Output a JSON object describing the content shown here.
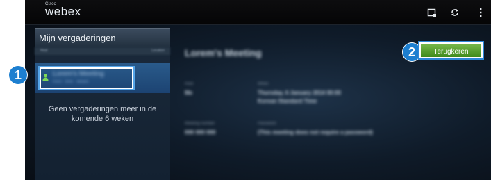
{
  "app": {
    "brand_top": "Cisco",
    "brand_name": "webex"
  },
  "toolbar": {
    "icons": [
      "add-meeting-icon",
      "refresh-icon",
      "more-icon"
    ]
  },
  "sidebar": {
    "title": "Mijn vergaderingen",
    "col_left": "Host",
    "col_right": "Location",
    "selected_meeting": {
      "title": "Lorem's Meeting",
      "subtitle": "Host · time · details"
    },
    "empty_message": "Geen vergaderingen meer in de komende 6 weken"
  },
  "detail": {
    "title": "Lorem's Meeting",
    "host_label": "Host",
    "host_value": "Me",
    "when_label": "When",
    "when_value": "Thursday, 6 January 2014 00:00",
    "when_value2": "Korean Standard Time",
    "number_label": "Meeting number",
    "number_value": "000 000 000",
    "password_label": "Password",
    "password_value": "(This meeting does not require a password)"
  },
  "actions": {
    "return_label": "Terugkeren"
  },
  "callouts": {
    "one": "1",
    "two": "2"
  },
  "colors": {
    "accent_green": "#5aa332",
    "callout_blue": "#1d7fd0",
    "selection_blue": "#2a5b8b"
  }
}
